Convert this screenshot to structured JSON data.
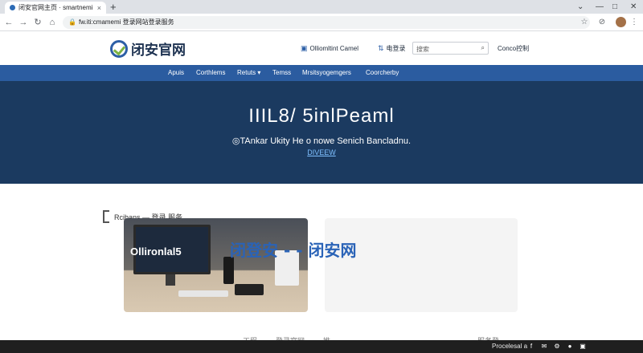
{
  "browser": {
    "tab_title": "闭安官网主页 · smartnemi 登录服务",
    "tab_close": "×",
    "new_tab": "+",
    "window_controls": [
      "⌄",
      "—",
      "□",
      "✕"
    ],
    "nav": {
      "back": "←",
      "forward": "→",
      "reload": "↻",
      "home": "⌂"
    },
    "address": "fw.iti:cmamemi 登录网站登录服务",
    "lock": "🔒",
    "toolbar_icons": {
      "bookmark": "☆",
      "extension": "⊘",
      "menu": "⋮"
    }
  },
  "site": {
    "logo_text": "闭安官网",
    "header_links": [
      {
        "icon": "▣",
        "label": "Olliomltint Camel"
      },
      {
        "icon": "⇅",
        "label": "电登录"
      }
    ],
    "search": {
      "placeholder": "搜索",
      "icon": "⌕"
    },
    "contact": "Conco控制"
  },
  "nav_items": [
    "Apuis",
    "Corthlems",
    "Retuts ▾",
    "Temss",
    "Mrsitsyogemgers",
    "Coorcherby"
  ],
  "hero": {
    "title": "IIIL8/ 5inlPeaml",
    "subtitle": "◎TAnkar Ukity He o nowe Senich Bancladnu.",
    "link": "DIVEEW"
  },
  "content": {
    "section_heading": "Rcibans — 登录 服务",
    "card1_label": "Ollironlal5",
    "overlay": "闭登安 - - 闭安网",
    "footer_left": "工程 —— 登录官网 —— 推",
    "footer_right": "服务登"
  },
  "taskbar": {
    "text": "Procelesal a",
    "icons": [
      "f",
      "✉",
      "⚙",
      "●",
      "▣"
    ]
  },
  "colors": {
    "nav_bar": "#2b5ca0",
    "hero_bg": "#1b3a60",
    "logo_blue": "#2d5fa6",
    "logo_green": "#7cb342",
    "overlay_blue": "#2a63b7"
  }
}
